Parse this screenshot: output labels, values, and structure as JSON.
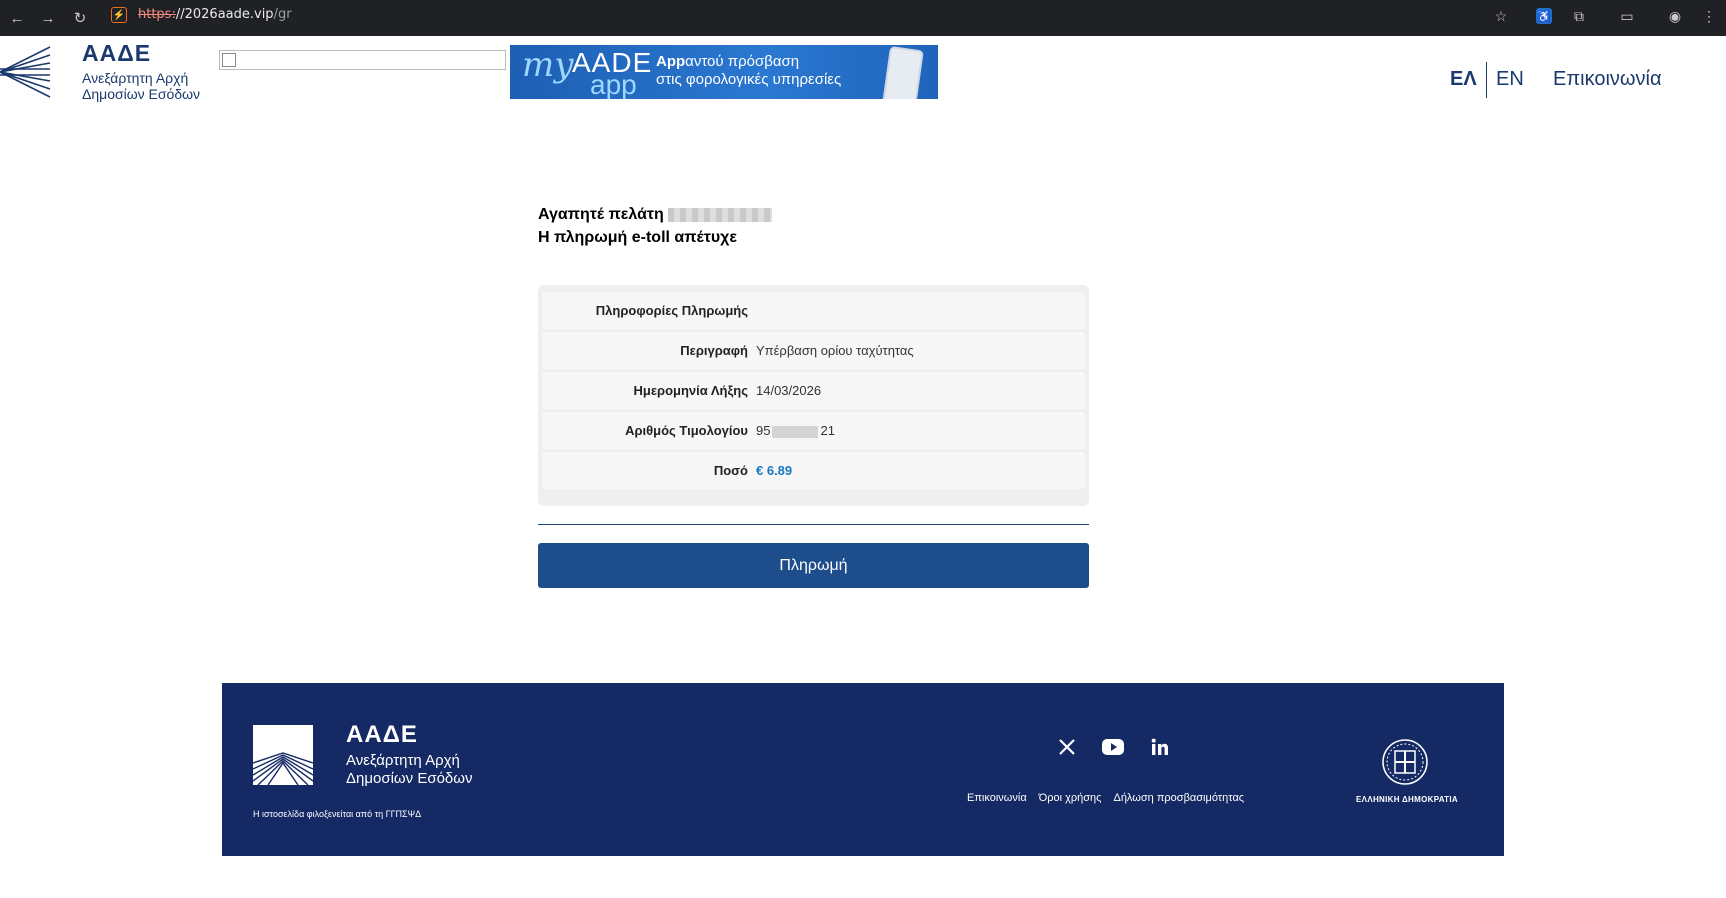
{
  "browser": {
    "url_scheme": "https:",
    "url_host": "//2026aade.vip",
    "url_path": "/gr"
  },
  "header": {
    "logo_title": "ΑΑΔΕ",
    "logo_sub_line1": "Ανεξάρτητη Αρχή",
    "logo_sub_line2": "Δημοσίων Εσόδων",
    "banner_my": "my",
    "banner_aade": "AADE",
    "banner_app": "app",
    "banner_line1_bold": "App",
    "banner_line1_rest": "αντού πρόσβαση",
    "banner_line2": "στις φορολογικές υπηρεσίες",
    "lang_el": "ΕΛ",
    "lang_en": "EN",
    "contact": "Επικοινωνία"
  },
  "main": {
    "greeting": "Αγαπητέ πελάτη",
    "status": "Η πληρωμή e-toll απέτυχε",
    "info_title": "Πληροφορίες Πληρωμής",
    "rows": [
      {
        "label": "Περιγραφή",
        "value": "Υπέρβαση ορίου ταχύτητας"
      },
      {
        "label": "Ημερομηνία Λήξης",
        "value": "14/03/2026"
      },
      {
        "label": "Αριθμός Τιμολογίου",
        "value_prefix": "95",
        "value_suffix": "21"
      },
      {
        "label": "Ποσό",
        "value": "€ 6.89"
      }
    ],
    "pay_button": "Πληρωμή"
  },
  "footer": {
    "logo_title": "ΑΑΔΕ",
    "logo_sub_line1": "Ανεξάρτητη Αρχή",
    "logo_sub_line2": "Δημοσίων Εσόδων",
    "hosting": "Η ιστοσελίδα φιλοξενείται από τη ΓΓΠΣΨΔ",
    "links": [
      "Επικοινωνία",
      "Όροι χρήσης",
      "Δήλωση προσβασιμότητας"
    ],
    "republic": "ΕΛΛΗΝΙΚΗ ΔΗΜΟΚΡΑΤΙΑ",
    "social_icons": [
      "x-icon",
      "youtube-icon",
      "linkedin-icon"
    ]
  },
  "colors": {
    "brand_navy": "#152a64",
    "button_blue": "#1e4d8c",
    "amount_blue": "#1a78c2"
  }
}
